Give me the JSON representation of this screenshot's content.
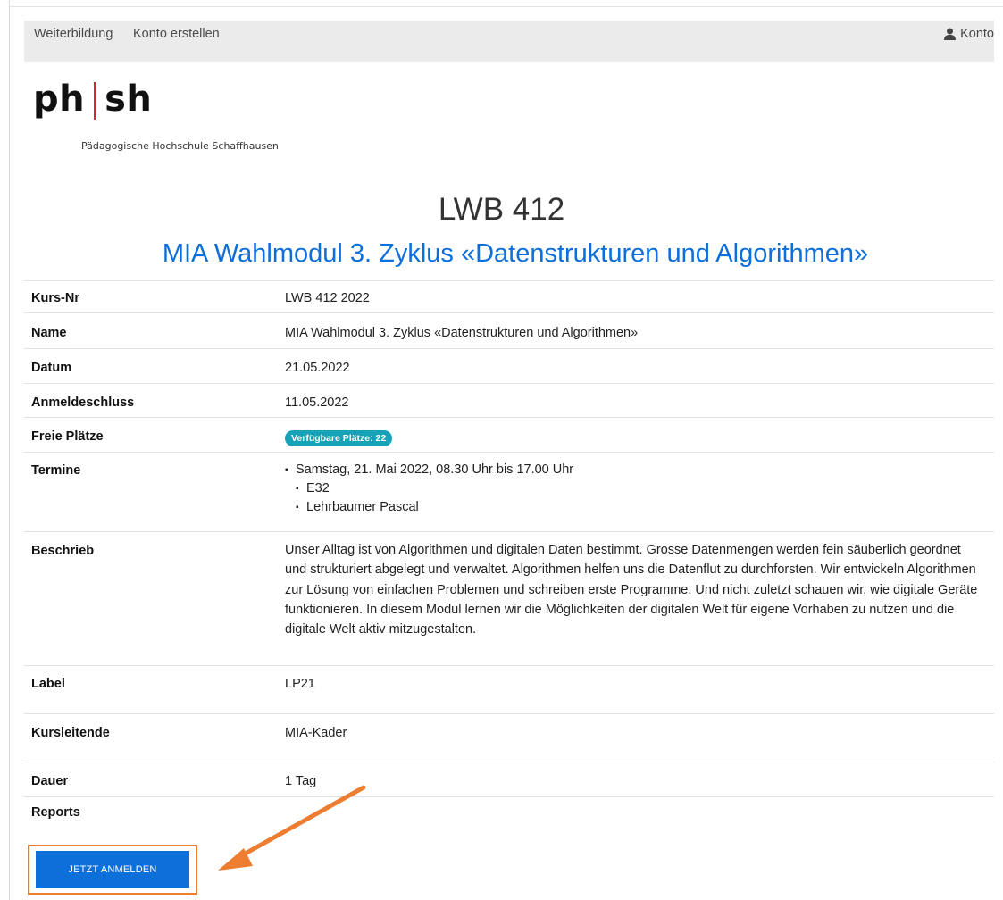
{
  "nav": {
    "links": [
      "Weiterbildung",
      "Konto erstellen"
    ],
    "account_label": "Konto"
  },
  "logo": {
    "left": "ph",
    "right": "sh",
    "subtitle": "Pädagogische Hochschule Schaffhausen"
  },
  "course": {
    "code_title": "LWB 412",
    "name_title": "MIA Wahlmodul 3. Zyklus «Datenstrukturen und Algorithmen»"
  },
  "details": {
    "kursnr_label": "Kurs-Nr",
    "kursnr": "LWB 412 2022",
    "name_label": "Name",
    "name": "MIA Wahlmodul 3. Zyklus «Datenstrukturen und Algorithmen»",
    "datum_label": "Datum",
    "datum": "21.05.2022",
    "anmeldeschluss_label": "Anmeldeschluss",
    "anmeldeschluss": "11.05.2022",
    "freie_plaetze_label": "Freie Plätze",
    "freie_plaetze_badge": "Verfügbare Plätze: 22",
    "termine_label": "Termine",
    "termin": "Samstag, 21. Mai 2022, 08.30 Uhr bis 17.00 Uhr",
    "termin_raum": "E32",
    "termin_leitung": "Lehrbaumer Pascal",
    "beschrieb_label": "Beschrieb",
    "beschrieb": "Unser Alltag ist von Algorithmen und digitalen Daten bestimmt. Grosse Datenmengen werden fein säuberlich geordnet und strukturiert abgelegt und verwaltet. Algorithmen helfen uns die Datenflut zu durchforsten. Wir entwickeln Algorithmen zur Lösung von einfachen Problemen und schreiben erste Programme. Und nicht zuletzt schauen wir, wie digitale Geräte funktionieren. In diesem Modul lernen wir die Möglichkeiten der digitalen Welt für eigene Vorhaben zu nutzen und die digitale Welt aktiv mitzugestalten.",
    "label_label": "Label",
    "label": "LP21",
    "kursleitende_label": "Kursleitende",
    "kursleitende": "MIA-Kader",
    "dauer_label": "Dauer",
    "dauer": "1 Tag",
    "reports_label": "Reports"
  },
  "actions": {
    "register_button": "JETZT ANMELDEN"
  },
  "colors": {
    "accent": "#0d6fd9",
    "badge": "#17a2b8",
    "highlight": "#ed7d31",
    "logo_bar": "#d8262c"
  }
}
